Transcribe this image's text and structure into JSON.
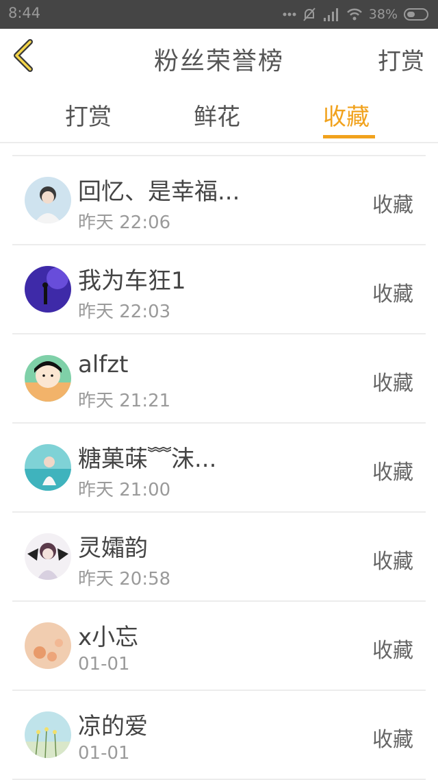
{
  "status_bar": {
    "time": "8:44",
    "battery": "38%"
  },
  "header": {
    "title": "粉丝荣誉榜",
    "action": "打赏"
  },
  "tabs": [
    {
      "label": "打赏",
      "active": false
    },
    {
      "label": "鲜花",
      "active": false
    },
    {
      "label": "收藏",
      "active": true
    }
  ],
  "accent_color": "#f1a21d",
  "items": [
    {
      "name": "回忆、是幸福...",
      "time": "昨天 22:06",
      "action": "收藏"
    },
    {
      "name": "我为车狂1",
      "time": "昨天 22:03",
      "action": "收藏"
    },
    {
      "name": "alfzt",
      "time": "昨天 21:21",
      "action": "收藏"
    },
    {
      "name": "糖菓菋﹌沫...",
      "time": "昨天 21:00",
      "action": "收藏"
    },
    {
      "name": "灵孀韵",
      "time": "昨天 20:58",
      "action": "收藏"
    },
    {
      "name": "x小忘",
      "time": "01-01",
      "action": "收藏"
    },
    {
      "name": "凉的爱",
      "time": "01-01",
      "action": "收藏"
    }
  ]
}
